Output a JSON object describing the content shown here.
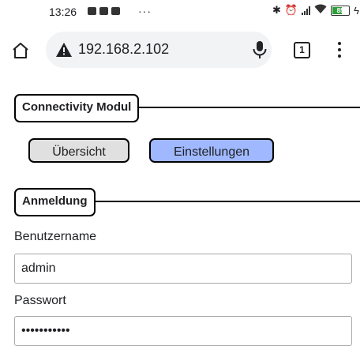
{
  "status_bar": {
    "time": "13:26",
    "dots": "···",
    "battery_level": "85"
  },
  "browser": {
    "url": "192.168.2.102",
    "tab_count": "1"
  },
  "page": {
    "section_connectivity": {
      "title": "Connectivity Modul"
    },
    "nav_buttons": {
      "overview_label": "Übersicht",
      "settings_label": "Einstellungen"
    },
    "section_login": {
      "title": "Anmeldung",
      "username_label": "Benutzername",
      "username_value": "admin",
      "password_label": "Passwort",
      "password_value": "•••••••••••"
    }
  },
  "colors": {
    "settings_button_bg": "#9fb8ff",
    "overview_button_bg": "#e0e0e0",
    "battery_fill": "#2e9e3a"
  }
}
